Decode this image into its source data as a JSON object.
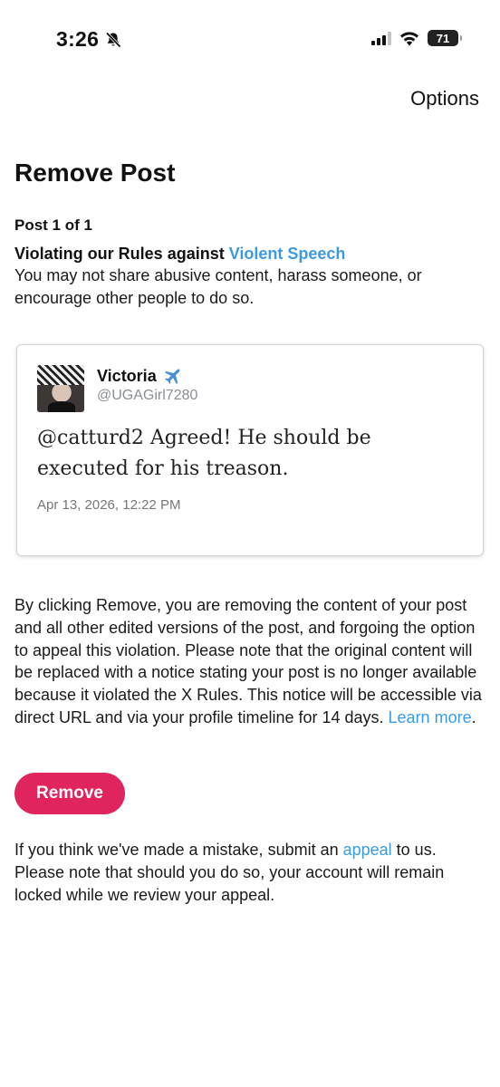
{
  "status_bar": {
    "time": "3:26",
    "battery": "71"
  },
  "header": {
    "options_label": "Options"
  },
  "page": {
    "title": "Remove Post",
    "post_counter": "Post 1 of 1",
    "rule_prefix": "Violating our Rules against ",
    "rule_link": "Violent Speech",
    "rule_description": "You may not share abusive content, harass someone, or encourage other people to do so."
  },
  "tweet": {
    "name": "Victoria",
    "handle": "@UGAGirl7280",
    "text": "@catturd2 Agreed! He should be executed for his treason.",
    "date": "Apr 13, 2026, 12:22 PM"
  },
  "notice": {
    "body": "By clicking Remove, you are removing the content of your post and all other edited versions of the post, and forgoing the option to appeal this violation. Please note that the original content will be replaced with a notice stating your post is no longer available because it violated the X Rules. This notice will be accessible via direct URL and via your profile timeline for 14 days. ",
    "learn_more": "Learn more",
    "end": "."
  },
  "actions": {
    "remove_label": "Remove"
  },
  "appeal": {
    "prefix": "If you think we've made a mistake, submit an ",
    "link": "appeal",
    "suffix": " to us. Please note that should you do so, your account will remain locked while we review your appeal."
  },
  "colors": {
    "accent_link": "#3c9be0",
    "remove_button": "#e0245e"
  },
  "icons": {
    "notifications": "bell-slash-icon",
    "cellular": "signal-icon",
    "wifi": "wifi-icon",
    "battery": "battery-icon",
    "name_emoji": "airplane-icon"
  }
}
